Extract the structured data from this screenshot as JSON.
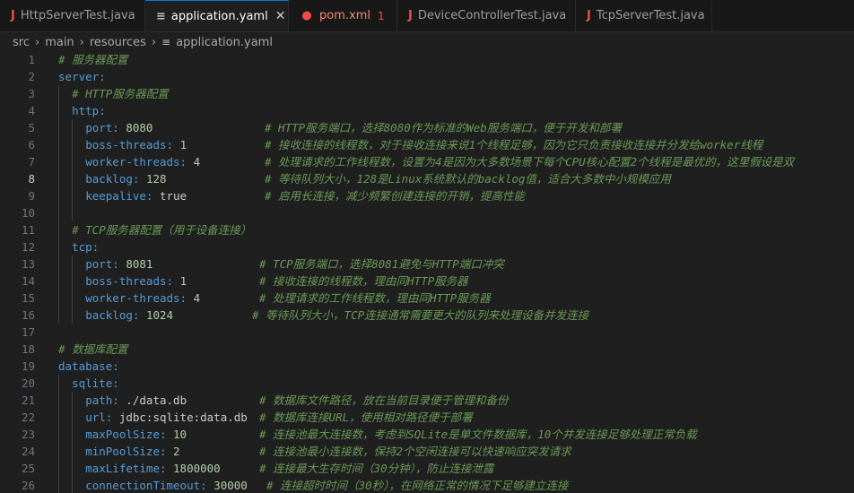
{
  "tabs": [
    {
      "label": "HttpServerTest.java",
      "icon": "java-icon",
      "active": false
    },
    {
      "label": "application.yaml",
      "icon": "yaml-file-icon",
      "active": true
    },
    {
      "label": "pom.xml",
      "icon": "xml-file-icon",
      "active": false,
      "badge": "1"
    },
    {
      "label": "DeviceControllerTest.java",
      "icon": "java-icon",
      "active": false
    },
    {
      "label": "TcpServerTest.java",
      "icon": "java-icon",
      "active": false
    }
  ],
  "breadcrumb": [
    "src",
    "main",
    "resources",
    "application.yaml"
  ],
  "editor": {
    "current_line": 8,
    "lines": [
      {
        "num": "1",
        "indent": 0,
        "key": "",
        "value": "",
        "comment": "# 服务器配置"
      },
      {
        "num": "2",
        "indent": 0,
        "key": "server:",
        "value": "",
        "comment": ""
      },
      {
        "num": "3",
        "indent": 1,
        "key": "",
        "value": "",
        "comment": "# HTTP服务器配置"
      },
      {
        "num": "4",
        "indent": 1,
        "key": "http:",
        "value": "",
        "comment": ""
      },
      {
        "num": "5",
        "indent": 2,
        "key": "port:",
        "value": "8080",
        "comment": "# HTTP服务端口，选择8080作为标准的Web服务端口，便于开发和部署"
      },
      {
        "num": "6",
        "indent": 2,
        "key": "boss-threads:",
        "value": "1",
        "comment": "# 接收连接的线程数，对于接收连接来说1个线程足够，因为它只负责接收连接并分发给worker线程"
      },
      {
        "num": "7",
        "indent": 2,
        "key": "worker-threads:",
        "value": "4",
        "comment": "# 处理请求的工作线程数，设置为4是因为大多数场景下每个CPU核心配置2个线程是最优的，这里假设是双"
      },
      {
        "num": "8",
        "indent": 2,
        "key": "backlog:",
        "value": "128",
        "comment": "# 等待队列大小，128是Linux系统默认的backlog值，适合大多数中小规模应用"
      },
      {
        "num": "9",
        "indent": 2,
        "key": "keepalive:",
        "value": "true",
        "comment": "# 启用长连接，减少频繁创建连接的开销，提高性能"
      },
      {
        "num": "10",
        "indent": 2,
        "key": "",
        "value": "",
        "comment": ""
      },
      {
        "num": "11",
        "indent": 1,
        "key": "",
        "value": "",
        "comment": "# TCP服务器配置（用于设备连接）"
      },
      {
        "num": "12",
        "indent": 1,
        "key": "tcp:",
        "value": "",
        "comment": ""
      },
      {
        "num": "13",
        "indent": 2,
        "key": "port:",
        "value": "8081",
        "comment": "# TCP服务端口，选择8081避免与HTTP端口冲突"
      },
      {
        "num": "14",
        "indent": 2,
        "key": "boss-threads:",
        "value": "1",
        "comment": "# 接收连接的线程数，理由同HTTP服务器"
      },
      {
        "num": "15",
        "indent": 2,
        "key": "worker-threads:",
        "value": "4",
        "comment": "# 处理请求的工作线程数，理由同HTTP服务器"
      },
      {
        "num": "16",
        "indent": 2,
        "key": "backlog:",
        "value": "1024",
        "comment": "# 等待队列大小，TCP连接通常需要更大的队列来处理设备并发连接"
      },
      {
        "num": "17",
        "indent": 0,
        "key": "",
        "value": "",
        "comment": ""
      },
      {
        "num": "18",
        "indent": 0,
        "key": "",
        "value": "",
        "comment": "# 数据库配置"
      },
      {
        "num": "19",
        "indent": 0,
        "key": "database:",
        "value": "",
        "comment": ""
      },
      {
        "num": "20",
        "indent": 1,
        "key": "sqlite:",
        "value": "",
        "comment": ""
      },
      {
        "num": "21",
        "indent": 2,
        "key": "path:",
        "value": "./data.db",
        "comment": "# 数据库文件路径，放在当前目录便于管理和备份"
      },
      {
        "num": "22",
        "indent": 2,
        "key": "url:",
        "value": "jdbc:sqlite:data.db",
        "comment": "# 数据库连接URL，使用相对路径便于部署"
      },
      {
        "num": "23",
        "indent": 2,
        "key": "maxPoolSize:",
        "value": "10",
        "comment": "# 连接池最大连接数，考虑到SQLite是单文件数据库，10个并发连接足够处理正常负载"
      },
      {
        "num": "24",
        "indent": 2,
        "key": "minPoolSize:",
        "value": "2",
        "comment": "# 连接池最小连接数，保持2个空闲连接可以快速响应突发请求"
      },
      {
        "num": "25",
        "indent": 2,
        "key": "maxLifetime:",
        "value": "1800000",
        "comment": "# 连接最大生存时间（30分钟），防止连接泄露"
      },
      {
        "num": "26",
        "indent": 2,
        "key": "connectionTimeout:",
        "value": "30000",
        "comment": "# 连接超时时间（30秒），在网络正常的情况下足够建立连接"
      }
    ]
  },
  "colors": {
    "key": "#569cd6",
    "number": "#b5cea8",
    "string": "#ce9178",
    "comment": "#6a9955",
    "accent": "#0078d4"
  }
}
